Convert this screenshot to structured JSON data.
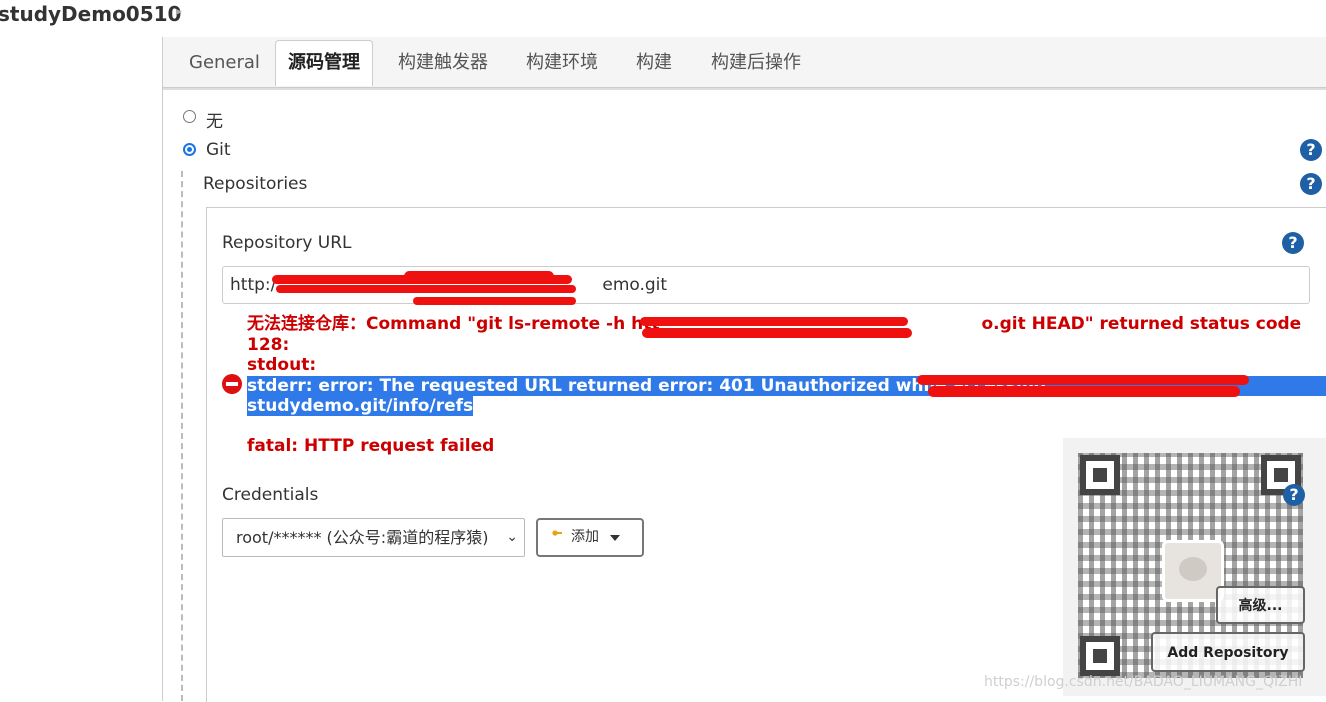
{
  "breadcrumb": {
    "project": "studyDemo0510"
  },
  "tabs": [
    {
      "label": "General"
    },
    {
      "label": "源码管理"
    },
    {
      "label": "构建触发器"
    },
    {
      "label": "构建环境"
    },
    {
      "label": "构建"
    },
    {
      "label": "构建后操作"
    }
  ],
  "scm": {
    "option_none": "无",
    "option_git": "Git",
    "selected": "Git"
  },
  "repositories": {
    "title": "Repositories",
    "url_label": "Repository URL",
    "url_value_prefix": "http:/",
    "url_value_suffix": "emo.git",
    "error": {
      "line1": "无法连接仓库：Command \"git ls-remote -h htt",
      "line1_tail": "o.git HEAD\" returned status code",
      "line2": "128:",
      "line3": "stdout:",
      "line4": "stderr: error: The requested URL returned error: 401 Unauthorized while accessing",
      "line5": "studydemo.git/info/refs",
      "line6": "fatal: HTTP request failed"
    }
  },
  "credentials": {
    "label": "Credentials",
    "selected": "root/****** (公众号:霸道的程序猿)",
    "add_button": "添加"
  },
  "buttons": {
    "advanced": "高级...",
    "add_repository": "Add Repository"
  },
  "help_icon_glyph": "?",
  "watermark": "https://blog.csdn.net/BADAO_LIUMANG_QIZHI",
  "colors": {
    "error": "#cc0000",
    "selection": "#2f7ae8",
    "help": "#1f5fa5",
    "redaction": "#ef1010"
  }
}
